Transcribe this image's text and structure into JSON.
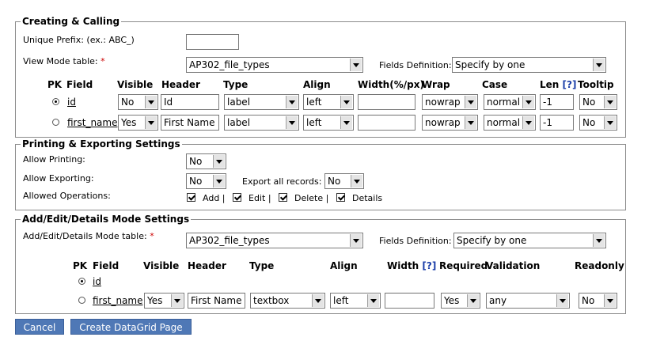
{
  "creating": {
    "legend": "Creating & Calling",
    "unique_prefix_label": "Unique Prefix: (ex.: ABC_)",
    "unique_prefix_value": "",
    "view_mode_label": "View Mode table:",
    "required_mark": "*",
    "view_mode_value": "AP302_file_types",
    "fields_def_label": "Fields Definition:",
    "fields_def_value": "Specify by one",
    "headers": {
      "pk": "PK",
      "field": "Field",
      "visible": "Visible",
      "header": "Header",
      "type": "Type",
      "align": "Align",
      "width": "Width(%/px)",
      "wrap": "Wrap",
      "case": "Case",
      "len": "Len",
      "help": "[?]",
      "tooltip": "Tooltip"
    },
    "rows": [
      {
        "field": "id",
        "visible": "No",
        "header": "Id",
        "type": "label",
        "align": "left",
        "width": "",
        "wrap": "nowrap",
        "case": "normal",
        "len": "-1",
        "tooltip": "No",
        "pk": true
      },
      {
        "field": "first_name",
        "visible": "Yes",
        "header": "First Name",
        "type": "label",
        "align": "left",
        "width": "",
        "wrap": "nowrap",
        "case": "normal",
        "len": "-1",
        "tooltip": "No",
        "pk": false
      }
    ]
  },
  "printing": {
    "legend": "Printing & Exporting Settings",
    "allow_printing_label": "Allow Printing:",
    "allow_printing_value": "No",
    "allow_exporting_label": "Allow Exporting:",
    "allow_exporting_value": "No",
    "export_all_label": "Export all records:",
    "export_all_value": "No",
    "allowed_ops_label": "Allowed Operations:",
    "ops": [
      {
        "label": "Add",
        "sep": "|"
      },
      {
        "label": "Edit",
        "sep": "|"
      },
      {
        "label": "Delete",
        "sep": "|"
      },
      {
        "label": "Details",
        "sep": ""
      }
    ]
  },
  "addedit": {
    "legend": "Add/Edit/Details Mode Settings",
    "mode_table_label": "Add/Edit/Details Mode table:",
    "required_mark": "*",
    "mode_table_value": "AP302_file_types",
    "fields_def_label": "Fields Definition:",
    "fields_def_value": "Specify by one",
    "headers": {
      "pk": "PK",
      "field": "Field",
      "visible": "Visible",
      "header": "Header",
      "type": "Type",
      "align": "Align",
      "width": "Width",
      "help": "[?]",
      "required": "Required",
      "validation": "Validation",
      "readonly": "Readonly"
    },
    "rows": [
      {
        "field": "id",
        "pk": true
      },
      {
        "field": "first_name",
        "visible": "Yes",
        "header": "First Name",
        "type": "textbox",
        "align": "left",
        "width": "",
        "required": "Yes",
        "validation": "any",
        "readonly": "No",
        "pk": false
      }
    ]
  },
  "buttons": {
    "cancel": "Cancel",
    "create": "Create DataGrid Page"
  }
}
